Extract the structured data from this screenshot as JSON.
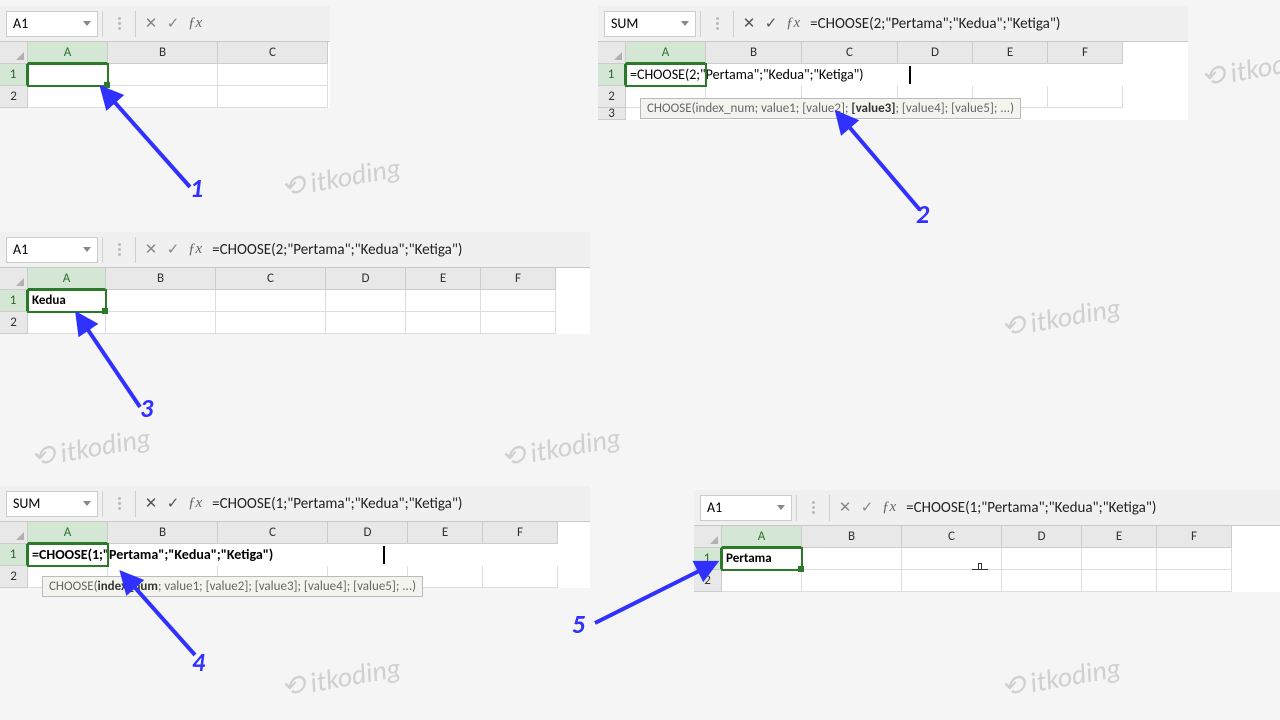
{
  "panel1": {
    "namebox": "A1",
    "formula": "",
    "columns": [
      "A",
      "B",
      "C"
    ],
    "rows": [
      "1",
      "2"
    ]
  },
  "panel2": {
    "namebox": "SUM",
    "formula": "=CHOOSE(2;\"Pertama\";\"Kedua\";\"Ketiga\")",
    "cell_formula": "=CHOOSE(2;\"Pertama\";\"Kedua\";\"Ketiga\")",
    "tooltip_prefix": "CHOOSE(index_num; value1; [value2]; ",
    "tooltip_bold": "[value3]",
    "tooltip_suffix": "; [value4]; [value5]; ...)",
    "columns": [
      "A",
      "B",
      "C",
      "D",
      "E",
      "F"
    ],
    "rows": [
      "1",
      "2",
      "3"
    ]
  },
  "panel3": {
    "namebox": "A1",
    "formula": "=CHOOSE(2;\"Pertama\";\"Kedua\";\"Ketiga\")",
    "result": "Kedua",
    "columns": [
      "A",
      "B",
      "C",
      "D",
      "E",
      "F"
    ],
    "rows": [
      "1",
      "2"
    ]
  },
  "panel4": {
    "namebox": "SUM",
    "formula": "=CHOOSE(1;\"Pertama\";\"Kedua\";\"Ketiga\")",
    "cell_formula": "=CHOOSE(1;\"Pertama\";\"Kedua\";\"Ketiga\")",
    "tooltip_prefix": "CHOOSE(",
    "tooltip_bold": "index_num",
    "tooltip_suffix": "; value1; [value2]; [value3]; [value4]; [value5]; ...)",
    "columns": [
      "A",
      "B",
      "C",
      "D",
      "E",
      "F"
    ],
    "rows": [
      "1",
      "2"
    ]
  },
  "panel5": {
    "namebox": "A1",
    "formula": "=CHOOSE(1;\"Pertama\";\"Kedua\";\"Ketiga\")",
    "result": "Pertama",
    "columns": [
      "A",
      "B",
      "C",
      "D",
      "E",
      "F"
    ],
    "rows": [
      "1",
      "2"
    ]
  },
  "labels": {
    "l1": "1",
    "l2": "2",
    "l3": "3",
    "l4": "4",
    "l5": "5"
  },
  "watermark_text": "⟲ itkoding"
}
